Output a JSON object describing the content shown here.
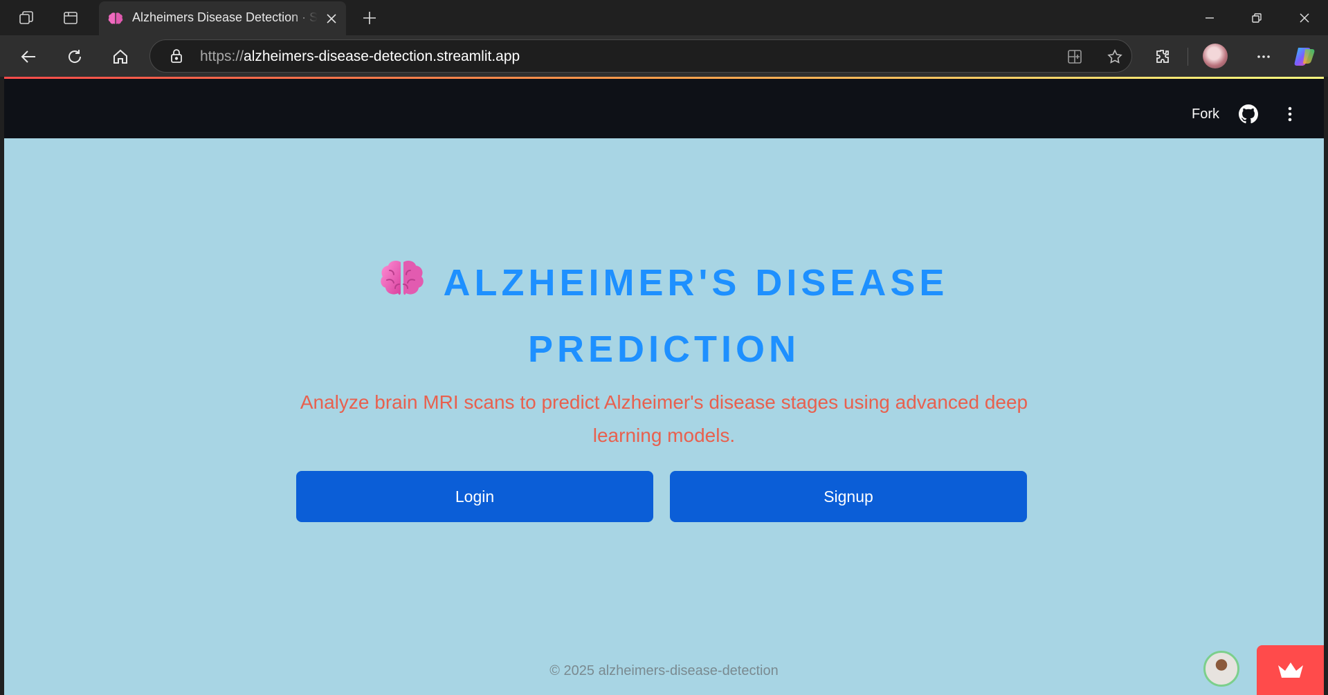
{
  "browser": {
    "tab": {
      "title": "Alzheimers Disease Detection · Streamlit"
    },
    "address": {
      "scheme": "https://",
      "host": "alzheimers-disease-detection.streamlit.app"
    }
  },
  "app_header": {
    "fork_label": "Fork"
  },
  "hero": {
    "title_line1": "ALZHEIMER'S DISEASE",
    "title_line2": "PREDICTION",
    "subtitle_line1": "Analyze brain MRI scans to predict Alzheimer's disease stages using advanced deep",
    "subtitle_line2": "learning models."
  },
  "buttons": {
    "login": "Login",
    "signup": "Signup"
  },
  "footer": {
    "text": "© 2025 alzheimers-disease-detection"
  },
  "colors": {
    "page_bg": "#a8d5e4",
    "title": "#1e90ff",
    "subtitle": "#e8604e",
    "button_bg": "#0b5ed7",
    "header_bg": "#0e1117",
    "streamlit_red": "#ff4b4b"
  },
  "icons": [
    "workspaces-icon",
    "tab-actions-icon",
    "brain-icon",
    "close-icon",
    "plus-icon",
    "minimize-icon",
    "restore-icon",
    "window-close-icon",
    "back-icon",
    "refresh-icon",
    "home-icon",
    "lock-icon",
    "split-screen-icon",
    "favorite-star-icon",
    "extensions-icon",
    "more-icon",
    "copilot-icon",
    "github-icon",
    "kebab-menu-icon",
    "streamlit-crown-icon"
  ]
}
